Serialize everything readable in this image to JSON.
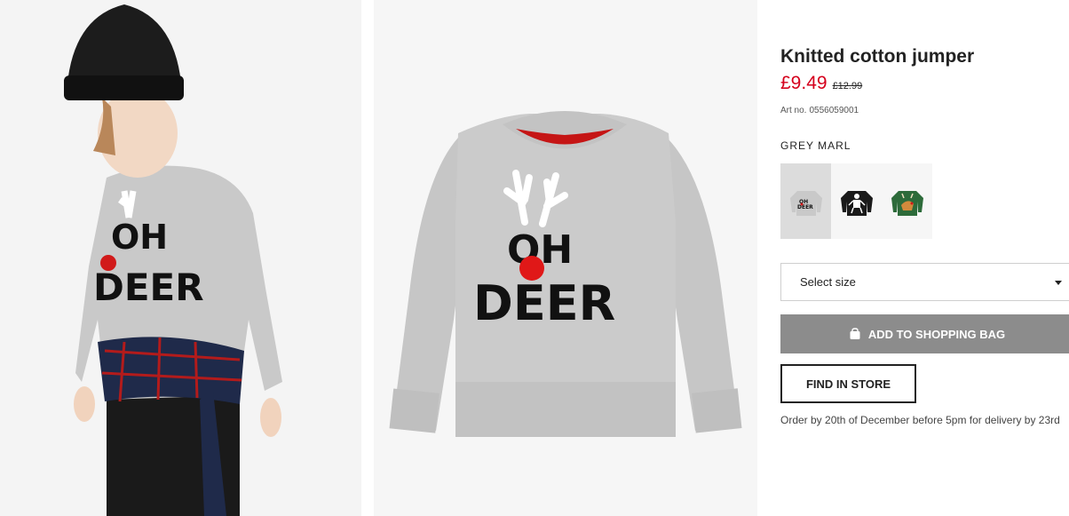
{
  "product": {
    "title": "Knitted cotton jumper",
    "price_current": "£9.49",
    "price_original": "£12.99",
    "art_no_label": "Art no.",
    "art_no_value": "0556059001",
    "colour_name": "GREY MARL"
  },
  "images": {
    "model_print_line1": "OH",
    "model_print_line2": "DEER",
    "flat_print_line1": "OH",
    "flat_print_line2": "DEER"
  },
  "swatches": [
    {
      "name": "Grey marl",
      "selected": true,
      "icon": "grey-oh-deer-jumper"
    },
    {
      "name": "Black",
      "selected": false,
      "icon": "black-skeleton-jumper"
    },
    {
      "name": "Green",
      "selected": false,
      "icon": "green-reindeer-jumper"
    }
  ],
  "size_select": {
    "label": "Select size"
  },
  "buttons": {
    "add_to_bag": "ADD TO SHOPPING BAG",
    "find_in_store": "FIND IN STORE"
  },
  "delivery_note": "Order by 20th of December before 5pm for delivery by 23rd",
  "colors": {
    "sale_red": "#d5001c",
    "add_button_bg": "#8c8c8c",
    "jumper_grey": "#c9c9c9",
    "selected_swatch_bg": "#dcdcdc"
  }
}
